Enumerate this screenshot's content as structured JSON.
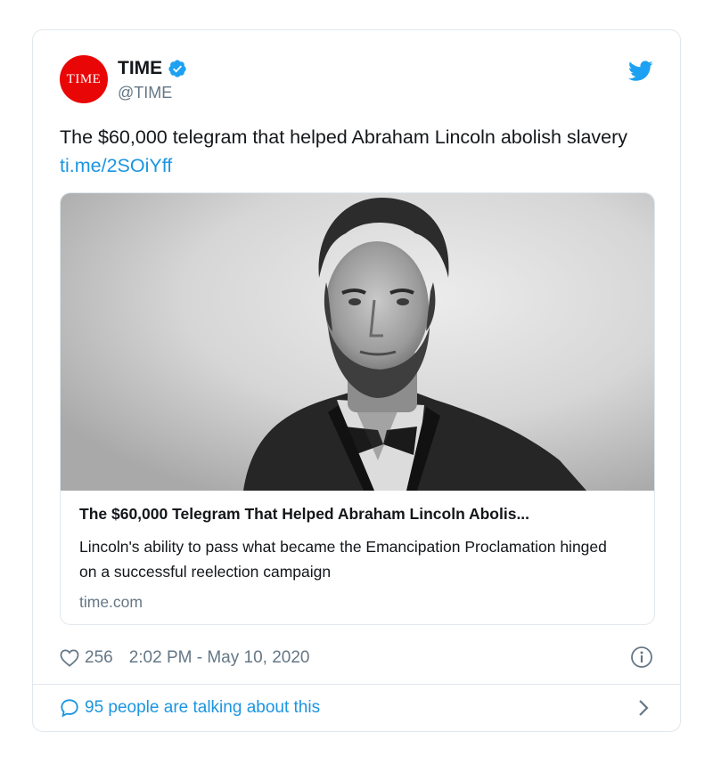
{
  "account": {
    "avatar_text": "TIME",
    "name": "TIME",
    "handle": "@TIME"
  },
  "tweet": {
    "text": "The $60,000 telegram that helped Abraham Lincoln abolish slavery",
    "link": "ti.me/2SOiYff"
  },
  "link_card": {
    "image_alt": "Portrait photograph of Abraham Lincoln",
    "title": "The $60,000 Telegram That Helped Abraham Lincoln Abolis...",
    "description": "Lincoln's ability to pass what became the Emancipation Proclamation hinged on a successful reelection campaign",
    "domain": "time.com"
  },
  "meta": {
    "likes": "256",
    "timestamp": "2:02 PM - May 10, 2020"
  },
  "footer": {
    "talking_text": "95 people are talking about this"
  },
  "icons": {
    "verified": "verified-badge-icon",
    "bird": "twitter-bird-icon",
    "heart": "heart-icon",
    "info": "info-icon",
    "reply": "reply-bubble-icon",
    "chevron": "chevron-right-icon"
  },
  "colors": {
    "brand_red": "#e90606",
    "link_blue": "#1b95e0",
    "muted_gray": "#657786",
    "border": "#e1e8ed"
  }
}
